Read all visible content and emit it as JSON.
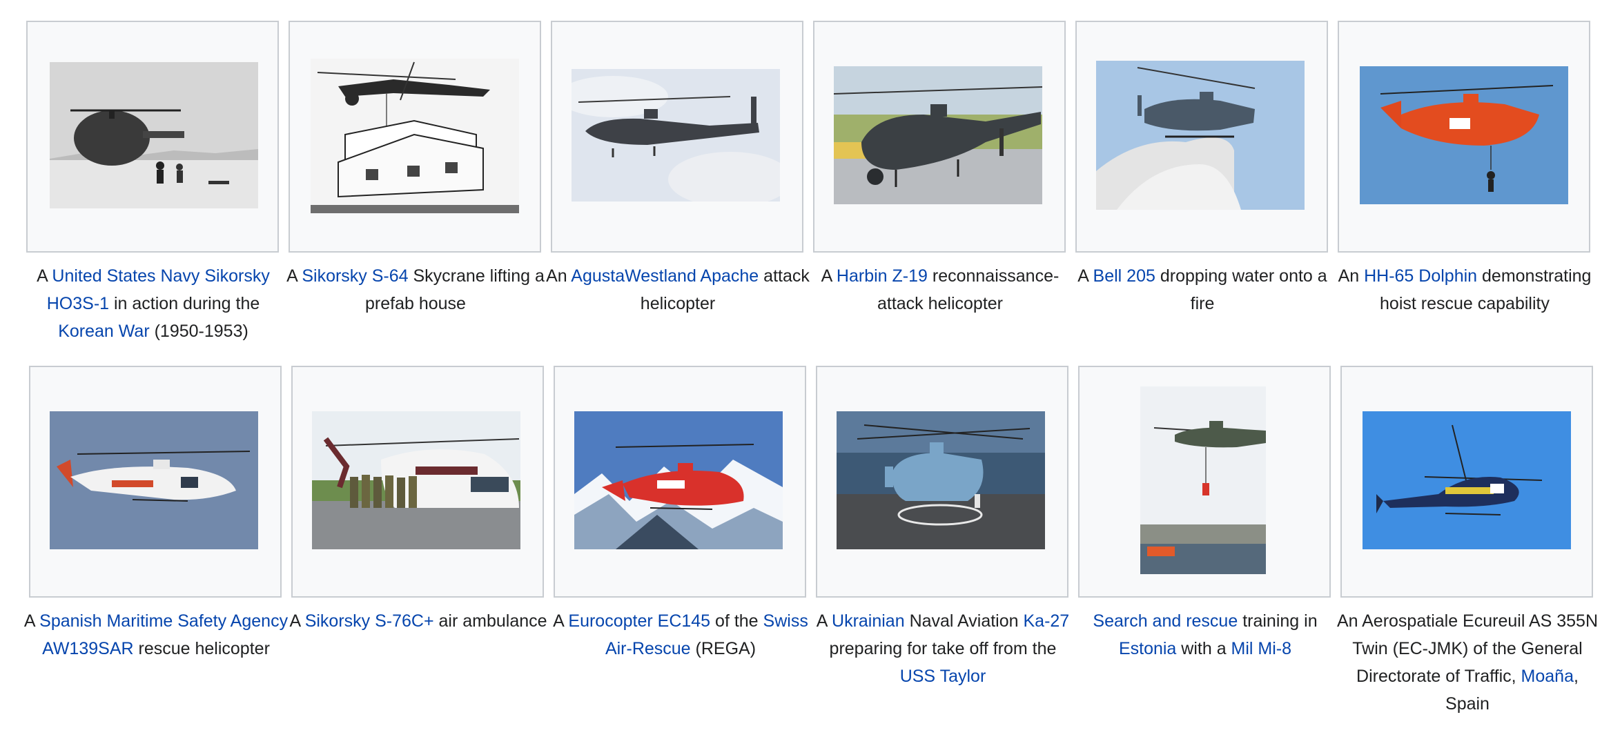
{
  "gallery": {
    "items": [
      {
        "photo_icon": "helicopter-photo-grayscale",
        "caption": [
          {
            "t": "A ",
            "link": false
          },
          {
            "t": "United States Navy Sikorsky HO3S-1",
            "link": true
          },
          {
            "t": " in action during the ",
            "link": false
          },
          {
            "t": "Korean War",
            "link": true
          },
          {
            "t": " (1950-1953)",
            "link": false
          }
        ]
      },
      {
        "photo_icon": "skycrane-lifting-house-photo",
        "caption": [
          {
            "t": "A ",
            "link": false
          },
          {
            "t": "Sikorsky S-64",
            "link": true
          },
          {
            "t": " Skycrane lifting a prefab house",
            "link": false
          }
        ]
      },
      {
        "photo_icon": "apache-helicopter-photo",
        "caption": [
          {
            "t": "An ",
            "link": false
          },
          {
            "t": "AgustaWestland Apache",
            "link": true
          },
          {
            "t": " attack helicopter",
            "link": false
          }
        ]
      },
      {
        "photo_icon": "z19-helicopter-photo",
        "caption": [
          {
            "t": "A ",
            "link": false
          },
          {
            "t": "Harbin Z-19",
            "link": true
          },
          {
            "t": " reconnaissance-attack helicopter",
            "link": false
          }
        ]
      },
      {
        "photo_icon": "bell205-dropping-water-photo",
        "caption": [
          {
            "t": "A ",
            "link": false
          },
          {
            "t": "Bell 205",
            "link": true
          },
          {
            "t": " dropping water onto a fire",
            "link": false
          }
        ]
      },
      {
        "photo_icon": "hh65-dolphin-photo",
        "caption": [
          {
            "t": "An ",
            "link": false
          },
          {
            "t": "HH-65 Dolphin",
            "link": true
          },
          {
            "t": " demonstrating hoist rescue capability",
            "link": false
          }
        ]
      },
      {
        "photo_icon": "aw139sar-helicopter-photo",
        "caption": [
          {
            "t": "A ",
            "link": false
          },
          {
            "t": "Spanish Maritime Safety Agency AW139SAR",
            "link": true
          },
          {
            "t": " rescue helicopter",
            "link": false
          }
        ]
      },
      {
        "photo_icon": "s76c-air-ambulance-photo",
        "caption": [
          {
            "t": "A ",
            "link": false
          },
          {
            "t": "Sikorsky S-76C+",
            "link": true
          },
          {
            "t": " air ambulance",
            "link": false
          }
        ]
      },
      {
        "photo_icon": "ec145-swiss-rescue-photo",
        "caption": [
          {
            "t": "A ",
            "link": false
          },
          {
            "t": "Eurocopter EC145",
            "link": true
          },
          {
            "t": " of the ",
            "link": false
          },
          {
            "t": "Swiss Air-Rescue",
            "link": true
          },
          {
            "t": " (REGA)",
            "link": false
          }
        ]
      },
      {
        "photo_icon": "ka27-ship-deck-photo",
        "caption": [
          {
            "t": "A ",
            "link": false
          },
          {
            "t": "Ukrainian",
            "link": true
          },
          {
            "t": " Naval Aviation ",
            "link": false
          },
          {
            "t": "Ka-27",
            "link": true
          },
          {
            "t": " preparing for take off from the ",
            "link": false
          },
          {
            "t": "USS Taylor",
            "link": true
          }
        ]
      },
      {
        "photo_icon": "mi8-rescue-training-photo",
        "caption": [
          {
            "t": "Search and rescue",
            "link": true
          },
          {
            "t": " training in ",
            "link": false
          },
          {
            "t": "Estonia",
            "link": true
          },
          {
            "t": " with a ",
            "link": false
          },
          {
            "t": "Mil Mi-8",
            "link": true
          }
        ]
      },
      {
        "photo_icon": "ecureuil-as355n-photo",
        "caption": [
          {
            "t": "An Aerospatiale Ecureuil AS 355N Twin (EC-JMK) of the General Directorate of Traffic, ",
            "link": false
          },
          {
            "t": "Moaña",
            "link": true
          },
          {
            "t": ", Spain",
            "link": false
          }
        ]
      }
    ]
  },
  "colors": {
    "link": "#0645ad",
    "text": "#202122",
    "frame_bg": "#f8f9fa",
    "frame_border": "#c8ccd1"
  }
}
